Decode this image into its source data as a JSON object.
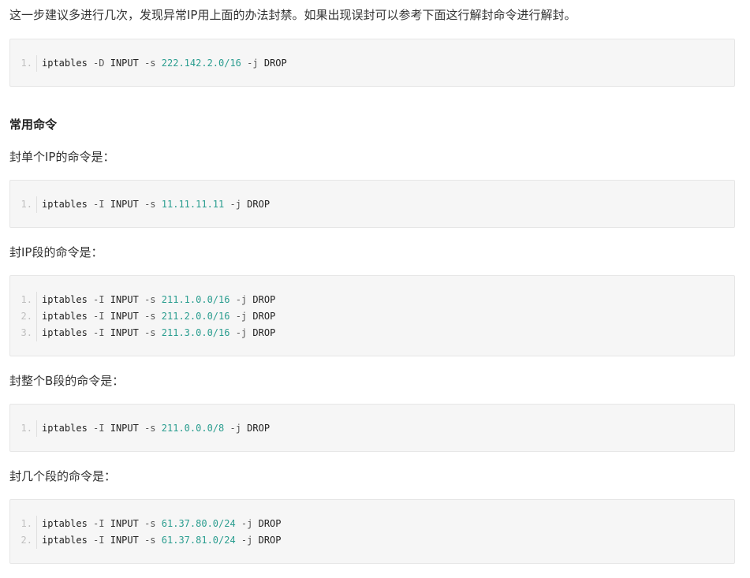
{
  "intro": "这一步建议多进行几次，发现异常IP用上面的办法封禁。如果出现误封可以参考下面这行解封命令进行解封。",
  "blocks": [
    {
      "lines": [
        {
          "num": "1.",
          "cmd": "iptables",
          "opt1": "-D",
          "chain": "INPUT",
          "opt2": "-s",
          "ip": "222.142.2.0/16",
          "opt3": "-j",
          "target": "DROP"
        }
      ]
    },
    {
      "lines": [
        {
          "num": "1.",
          "cmd": "iptables",
          "opt1": "-I",
          "chain": "INPUT",
          "opt2": "-s",
          "ip": "11.11.11.11",
          "opt3": "-j",
          "target": "DROP"
        }
      ]
    },
    {
      "lines": [
        {
          "num": "1.",
          "cmd": "iptables",
          "opt1": "-I",
          "chain": "INPUT",
          "opt2": "-s",
          "ip": "211.1.0.0/16",
          "opt3": "-j",
          "target": "DROP"
        },
        {
          "num": "2.",
          "cmd": "iptables",
          "opt1": "-I",
          "chain": "INPUT",
          "opt2": "-s",
          "ip": "211.2.0.0/16",
          "opt3": "-j",
          "target": "DROP"
        },
        {
          "num": "3.",
          "cmd": "iptables",
          "opt1": "-I",
          "chain": "INPUT",
          "opt2": "-s",
          "ip": "211.3.0.0/16",
          "opt3": "-j",
          "target": "DROP"
        }
      ]
    },
    {
      "lines": [
        {
          "num": "1.",
          "cmd": "iptables",
          "opt1": "-I",
          "chain": "INPUT",
          "opt2": "-s",
          "ip": "211.0.0.0/8",
          "opt3": "-j",
          "target": "DROP"
        }
      ]
    },
    {
      "lines": [
        {
          "num": "1.",
          "cmd": "iptables",
          "opt1": "-I",
          "chain": "INPUT",
          "opt2": "-s",
          "ip": "61.37.80.0/24",
          "opt3": "-j",
          "target": "DROP"
        },
        {
          "num": "2.",
          "cmd": "iptables",
          "opt1": "-I",
          "chain": "INPUT",
          "opt2": "-s",
          "ip": "61.37.81.0/24",
          "opt3": "-j",
          "target": "DROP"
        }
      ]
    }
  ],
  "section_heading": "常用命令",
  "label_single_ip": "封单个IP的命令是：",
  "label_ip_range": "封IP段的命令是：",
  "label_b_range": "封整个B段的命令是：",
  "label_multi_range": "封几个段的命令是：",
  "colors": {
    "code_bg": "#f6f6f6",
    "ip_literal": "#2a9d8f",
    "line_number": "#bfbfbf"
  }
}
